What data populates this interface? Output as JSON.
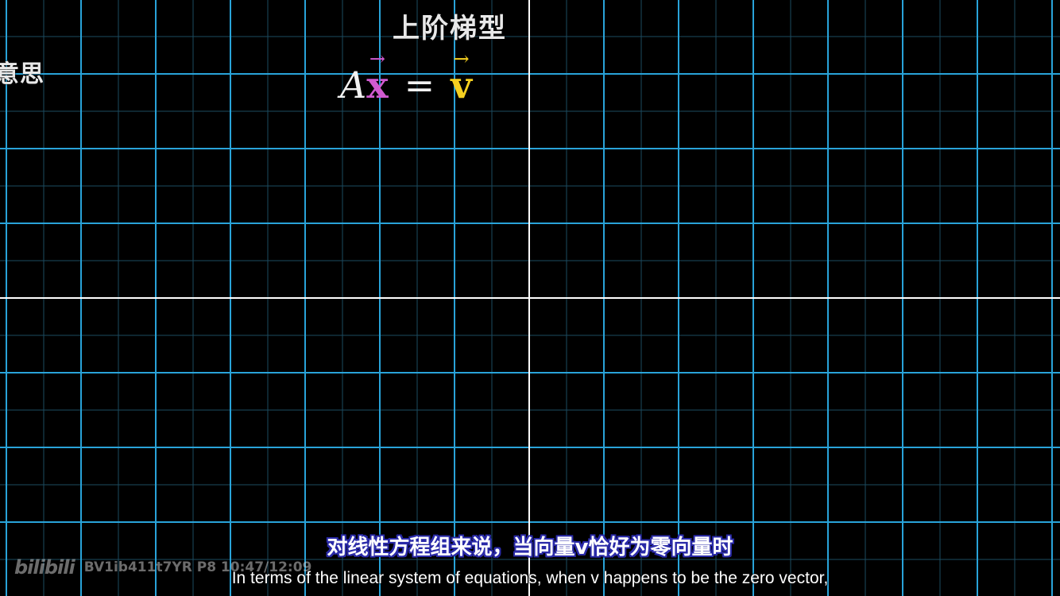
{
  "overlay": {
    "title_left": "意思",
    "title_top": "上阶梯型"
  },
  "equation": {
    "matrix": "A",
    "vector_x": "x",
    "equals": "=",
    "vector_v": "v",
    "arrow": "→"
  },
  "subtitles": {
    "chinese": "对线性方程组来说，当向量v恰好为零向量时",
    "english": "In terms of the linear system of equations, when v happens to be the zero vector,"
  },
  "watermark": {
    "logo": "bilibili",
    "video_info": "BV1ib411t7YR P8 10:47/12:09"
  },
  "colors": {
    "background": "#000000",
    "major_grid": "#29a3d9",
    "minor_grid": "#1c4b60",
    "axis": "#ffffff",
    "vector_x": "#d05ad0",
    "vector_v": "#f5d020",
    "subtitle_outline": "#2a2aa8"
  }
}
